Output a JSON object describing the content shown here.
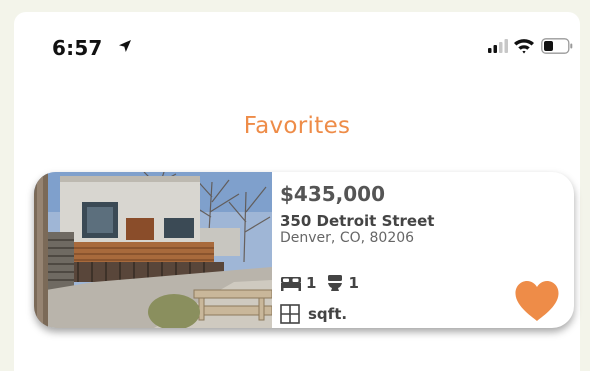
{
  "status_bar": {
    "time": "6:57",
    "icons": [
      "location-arrow-icon",
      "signal-icon",
      "wifi-icon",
      "battery-icon"
    ]
  },
  "page": {
    "title": "Favorites"
  },
  "listings": [
    {
      "price": "$435,000",
      "street": "350 Detroit Street",
      "city": "Denver, CO, 80206",
      "beds": "1",
      "baths": "1",
      "sqft_label": "sqft.",
      "favorited": true
    }
  ],
  "colors": {
    "accent": "#ee8c48",
    "background": "#f3f4ea",
    "card": "#ffffff",
    "text_dark": "#444444"
  }
}
